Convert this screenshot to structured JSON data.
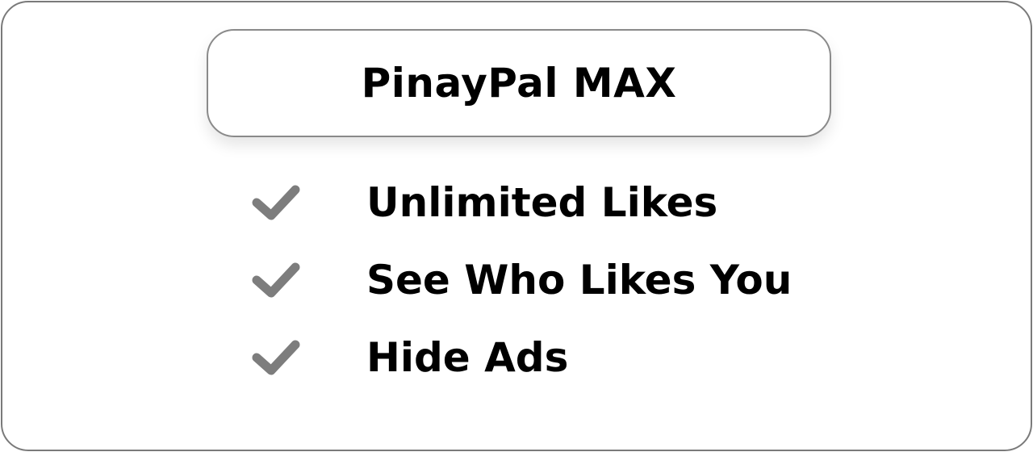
{
  "plan": {
    "title": "PinayPal MAX"
  },
  "features": [
    {
      "label": "Unlimited Likes",
      "icon": "check-icon"
    },
    {
      "label": "See Who Likes You",
      "icon": "check-icon"
    },
    {
      "label": "Hide Ads",
      "icon": "check-icon"
    }
  ],
  "colors": {
    "border": "#7a7a7a",
    "check": "#7d7d7d",
    "text": "#000000"
  }
}
